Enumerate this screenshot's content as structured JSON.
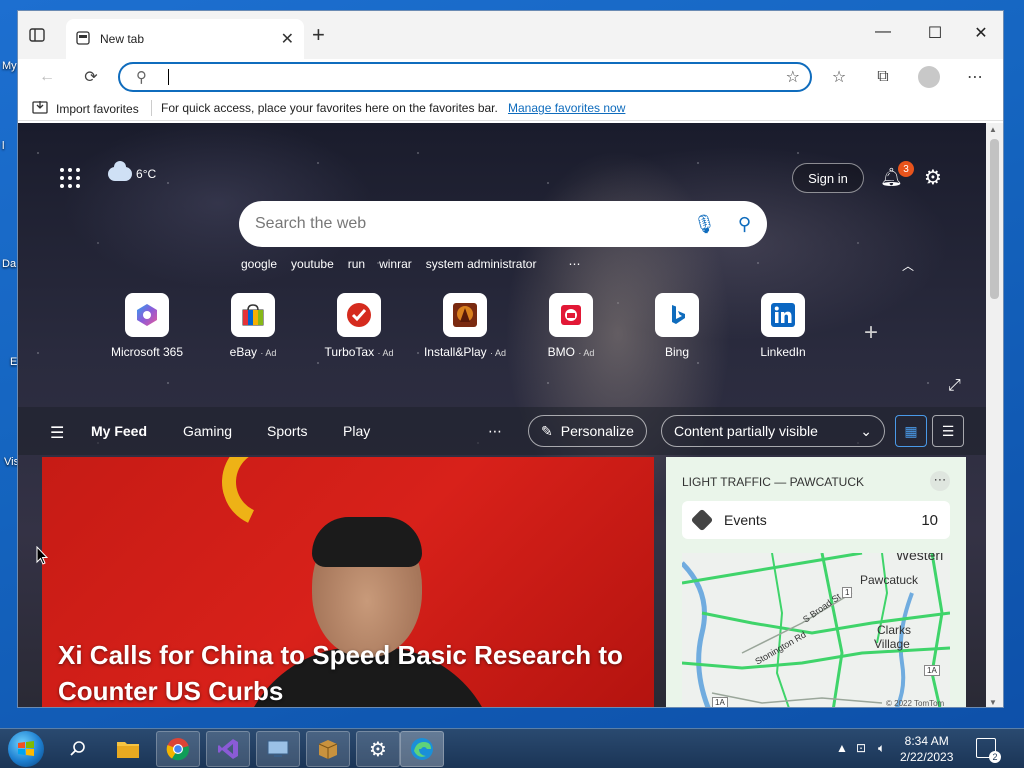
{
  "desktop": {
    "fragments": [
      "My",
      "l",
      "Da",
      "E",
      "Vis"
    ]
  },
  "browser": {
    "tab_title": "New tab",
    "address_value": "",
    "favorites_bar": {
      "import_label": "Import favorites",
      "hint": "For quick access, place your favorites here on the favorites bar.",
      "manage_link": "Manage favorites now"
    }
  },
  "ntp": {
    "weather_temp": "6",
    "weather_unit": "°C",
    "sign_in": "Sign in",
    "notification_count": "3",
    "search_placeholder": "Search the web",
    "trending": [
      "google",
      "youtube",
      "run",
      "winrar",
      "system administrator"
    ],
    "tiles": [
      {
        "name": "Microsoft 365",
        "ad": ""
      },
      {
        "name": "eBay",
        "ad": "· Ad"
      },
      {
        "name": "TurboTax",
        "ad": "· Ad"
      },
      {
        "name": "Install&Play",
        "ad": "· Ad"
      },
      {
        "name": "BMO",
        "ad": "· Ad"
      },
      {
        "name": "Bing",
        "ad": ""
      },
      {
        "name": "LinkedIn",
        "ad": ""
      }
    ],
    "feed_tabs": [
      "My Feed",
      "Gaming",
      "Sports",
      "Play"
    ],
    "personalize": "Personalize",
    "content_visibility": "Content partially visible",
    "hero_headline": "Xi Calls for China to Speed Basic Research to Counter US Curbs",
    "traffic": {
      "header": "LIGHT TRAFFIC — PAWCATUCK",
      "events_label": "Events",
      "events_count": "10",
      "map_labels": [
        "Westerl",
        "Pawcatuck",
        "Clarks",
        "Village",
        "Stonington Rd",
        "S Broad St",
        "1",
        "1A",
        "1A",
        "© 2022 TomTom"
      ]
    }
  },
  "taskbar": {
    "time": "8:34 AM",
    "date": "2/22/2023",
    "notification_count": "2"
  }
}
